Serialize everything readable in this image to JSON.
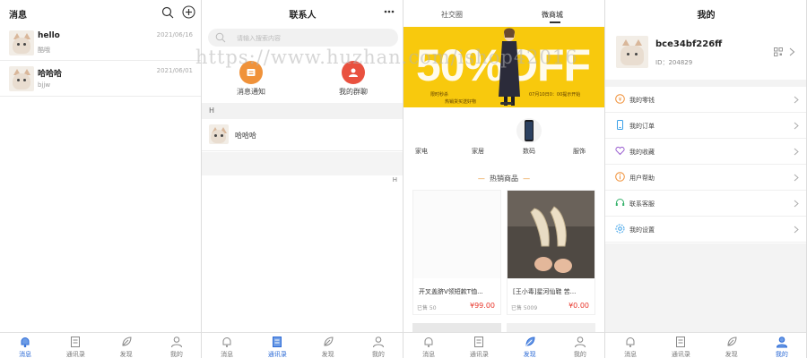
{
  "colors": {
    "accent": "#2d6bd6",
    "price": "#e8362b",
    "banner": "#f8c90d",
    "orange": "#f0923a",
    "red": "#e9513f"
  },
  "tabbar": {
    "items": [
      {
        "label": "消息",
        "icon": "bell-icon"
      },
      {
        "label": "通讯录",
        "icon": "contacts-icon"
      },
      {
        "label": "发现",
        "icon": "compass-leaf-icon"
      },
      {
        "label": "我的",
        "icon": "user-icon"
      }
    ]
  },
  "messages": {
    "title": "消息",
    "items": [
      {
        "name": "hello",
        "preview": "酷哦",
        "date": "2021/06/16"
      },
      {
        "name": "哈哈哈",
        "preview": "bjjw",
        "date": "2021/06/01"
      }
    ]
  },
  "contacts": {
    "title": "联系人",
    "search_placeholder": "请输入搜索内容",
    "actions": [
      {
        "label": "消息通知",
        "icon": "notification-icon"
      },
      {
        "label": "我的群聊",
        "icon": "group-chat-icon"
      }
    ],
    "section_letter": "H",
    "items": [
      {
        "name": "哈哈哈"
      }
    ],
    "index_letter": "H"
  },
  "shop": {
    "tabs": [
      {
        "label": "社交圈"
      },
      {
        "label": "微商城"
      }
    ],
    "banner": {
      "big_text": "50%OFF",
      "line1": "限时秒杀",
      "line2": "07月10日0：00提示开始",
      "line3": "热销货买送好物"
    },
    "categories": [
      {
        "label": "家电"
      },
      {
        "label": "家居"
      },
      {
        "label": "数码"
      },
      {
        "label": "服饰"
      }
    ],
    "hot_title": "热销商品",
    "products": [
      {
        "name": "开叉盖脐V领短款T恤...",
        "sold": "已售 50",
        "price": "¥99.00"
      },
      {
        "name": "[王小毒]星河仙鞋 苦...",
        "sold": "已售 5009",
        "price": "¥0.00"
      }
    ]
  },
  "me": {
    "title": "我的",
    "username": "bce34bf226ff",
    "user_id": "ID：204829",
    "menu": [
      {
        "label": "我的零钱",
        "icon": "wallet-icon"
      },
      {
        "label": "我的订单",
        "icon": "phone-order-icon"
      },
      {
        "label": "我的收藏",
        "icon": "heart-icon"
      },
      {
        "label": "用户帮助",
        "icon": "info-icon"
      },
      {
        "label": "联系客服",
        "icon": "headset-icon"
      },
      {
        "label": "我的设置",
        "icon": "settings-icon"
      }
    ]
  },
  "watermark": "https://www.huzhan.com/ishop42016"
}
